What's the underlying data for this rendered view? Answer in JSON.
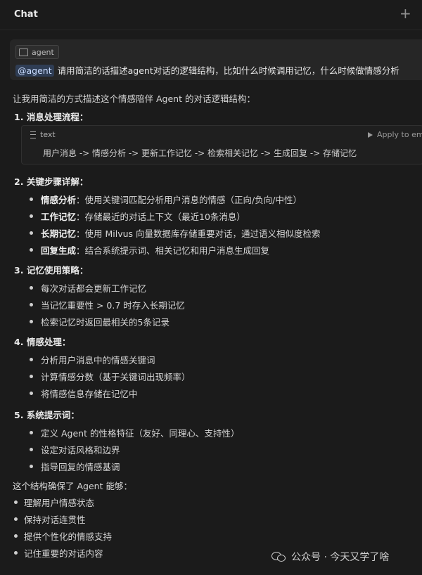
{
  "header": {
    "title": "Chat",
    "add_label": "+",
    "more_label": "⋮"
  },
  "user_message": {
    "context_chip": "agent",
    "mention": "@agent",
    "text": "请用简洁的话描述agent对话的逻辑结构，比如什么时候调用记忆，什么时候做情感分析"
  },
  "response": {
    "intro": "让我用简洁的方式描述这个情感陪伴 Agent 的对话逻辑结构：",
    "s1_num": "1.",
    "s1_title": "消息处理流程：",
    "code_lang": "text",
    "code_apply": "Apply to emo",
    "code_line": "用户消息  ->  情感分析  ->  更新工作记忆  ->  检索相关记忆  ->  生成回复  ->  存储记忆",
    "s2_num": "2.",
    "s2_title": "关键步骤详解：",
    "s2_items": [
      {
        "bold": "情感分析",
        "text": "：使用关键词匹配分析用户消息的情感（正向/负向/中性）"
      },
      {
        "bold": "工作记忆",
        "text": "：存储最近的对话上下文（最近10条消息）"
      },
      {
        "bold": "长期记忆",
        "text": "：使用 Milvus 向量数据库存储重要对话，通过语义相似度检索"
      },
      {
        "bold": "回复生成",
        "text": "：结合系统提示词、相关记忆和用户消息生成回复"
      }
    ],
    "s3_num": "3.",
    "s3_title": "记忆使用策略：",
    "s3_items": [
      "每次对话都会更新工作记忆",
      "当记忆重要性 > 0.7 时存入长期记忆",
      "检索记忆时返回最相关的5条记录"
    ],
    "s4_num": "4.",
    "s4_title": "情感处理：",
    "s4_items": [
      "分析用户消息中的情感关键词",
      "计算情感分数（基于关键词出现频率）",
      "将情感信息存储在记忆中"
    ],
    "s5_num": "5.",
    "s5_title": "系统提示词：",
    "s5_items": [
      "定义 Agent 的性格特征（友好、同理心、支持性）",
      "设定对话风格和边界",
      "指导回复的情感基调"
    ],
    "summary": "这个结构确保了 Agent 能够：",
    "summary_items": [
      "理解用户情感状态",
      "保持对话连贯性",
      "提供个性化的情感支持",
      "记住重要的对话内容"
    ]
  },
  "watermark": {
    "text": "公众号 · 今天又学了啥"
  }
}
